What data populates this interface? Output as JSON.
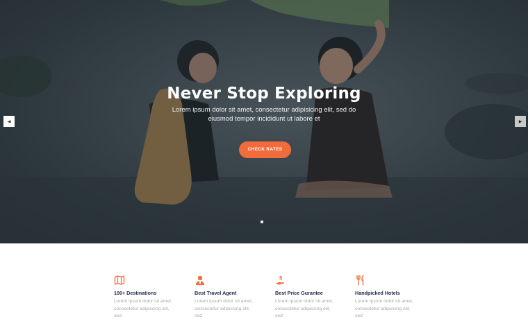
{
  "hero": {
    "title": "Never Stop Exploring",
    "subtitle": "Lorem ipsum dolor sit amet, consectetur adipisicing elit, sed do eiusmod tempor incididunt ut labore et",
    "cta_label": "CHECK RATES",
    "prev_arrow": "◀",
    "next_arrow": "▶"
  },
  "colors": {
    "accent": "#f26c3b",
    "feature_title": "#1e2a4a",
    "feature_text": "#a9a9a9"
  },
  "features": [
    {
      "icon": "map-icon",
      "title": "100+ Destinations",
      "desc": "Lorem ipsum dolor sit amet, consectetur adipiscing elit, sed"
    },
    {
      "icon": "agent-icon",
      "title": "Best Travel Agent",
      "desc": "Lorem ipsum dolor sit amet, consectetur adipiscing elit, sed"
    },
    {
      "icon": "price-hand-icon",
      "title": "Best Price Gurantee",
      "desc": "Lorem ipsum dolor sit amet, consectetur adipiscing elit, sed"
    },
    {
      "icon": "fork-knife-icon",
      "title": "Handpicked Hotels",
      "desc": "Lorem ipsum dolor sit amet, consectetur adipiscing elit, sed"
    }
  ]
}
